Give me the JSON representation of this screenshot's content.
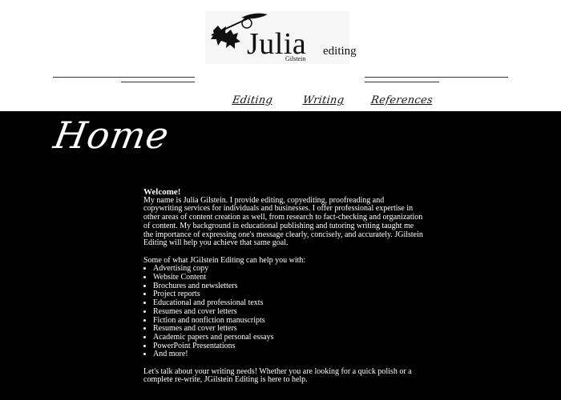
{
  "logo": {
    "name": "Julia",
    "sub": "Gilstein",
    "tagline": "editing"
  },
  "nav": {
    "items": [
      "Editing",
      "Writing",
      "References"
    ]
  },
  "page": {
    "title": "Home"
  },
  "content": {
    "welcome": "Welcome!",
    "intro": "My name is Julia Gilstein. I provide editing, copyediting, proofreading and copywriting services for individuals and businesses. I offer professional expertise in other areas of content creation as well, from research to fact-checking and organization of content. My background in educational publishing and tutoring writing taught me the importance of expressing one's message clearly, concisely, and accurately. JGilstein Editing will help you achieve that same goal.",
    "list_heading": "Some of what JGilstein Editing can help you with:",
    "list_items": [
      "Advertising copy",
      "Website Content",
      "Brochures and newsletters",
      "Project reports",
      "Educational and professional texts",
      "Resumes and cover letters",
      "Fiction and nonfiction manuscripts",
      "Resumes and cover letters",
      "Academic papers and personal essays",
      "PowerPoint Presentations",
      "And more!"
    ],
    "closing": "Let's talk about your writing needs! Whether you are looking for a quick polish or a complete re-write, JGilstein Editing is here to help."
  }
}
